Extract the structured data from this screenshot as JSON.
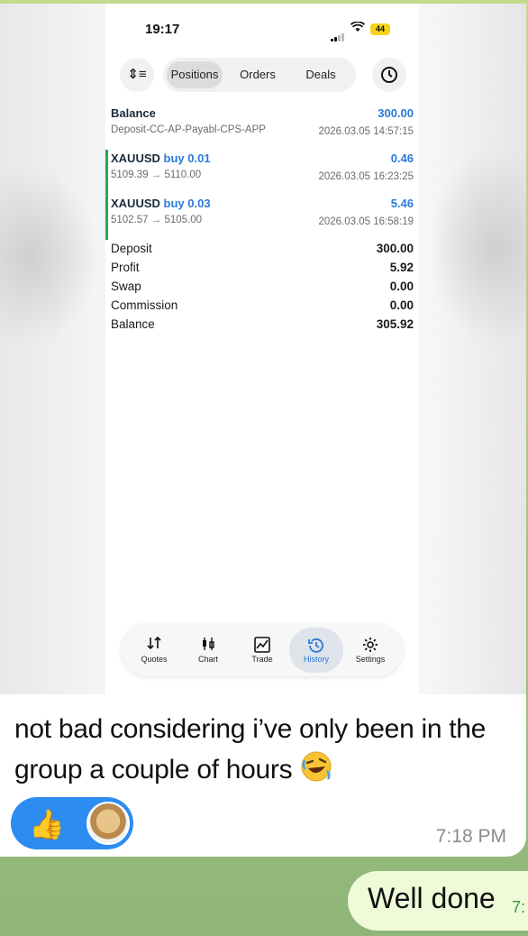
{
  "status_bar": {
    "time": "19:17",
    "battery": "44"
  },
  "segmented": {
    "items": [
      "Positions",
      "Orders",
      "Deals"
    ],
    "active": "Positions"
  },
  "history_rows": [
    {
      "type": "balance",
      "title": "Balance",
      "sub": "Deposit-CC-AP-Payabl-CPS-APP",
      "value": "300.00",
      "date": "2026.03.05 14:57:15"
    },
    {
      "type": "trade",
      "symbol": "XAUUSD",
      "side": "buy 0.01",
      "sub": "5109.39 → 5110.00",
      "value": "0.46",
      "date": "2026.03.05 16:23:25"
    },
    {
      "type": "trade",
      "symbol": "XAUUSD",
      "side": "buy 0.03",
      "sub": "5102.57 → 5105.00",
      "value": "5.46",
      "date": "2026.03.05 16:58:19"
    }
  ],
  "summary": [
    {
      "label": "Deposit",
      "value": "300.00"
    },
    {
      "label": "Profit",
      "value": "5.92"
    },
    {
      "label": "Swap",
      "value": "0.00"
    },
    {
      "label": "Commission",
      "value": "0.00"
    },
    {
      "label": "Balance",
      "value": "305.92"
    }
  ],
  "tabs": [
    {
      "label": "Quotes",
      "icon": "arrows-updown-icon"
    },
    {
      "label": "Chart",
      "icon": "candlestick-icon"
    },
    {
      "label": "Trade",
      "icon": "trade-chart-icon"
    },
    {
      "label": "History",
      "icon": "history-icon",
      "active": true
    },
    {
      "label": "Settings",
      "icon": "gear-icon"
    }
  ],
  "message": {
    "text": "not bad considering i’ve only been in the group a couple of hours",
    "emoji": "rofl-face-icon",
    "time": "7:18 PM",
    "reaction_emoji": "👍"
  },
  "reply": {
    "text": "Well done",
    "time": "7:"
  },
  "colors": {
    "accent": "#2a79d8",
    "trade_bar": "#2aa84a",
    "reaction_bg": "#2d8cf0",
    "reply_bg": "#effad8"
  }
}
